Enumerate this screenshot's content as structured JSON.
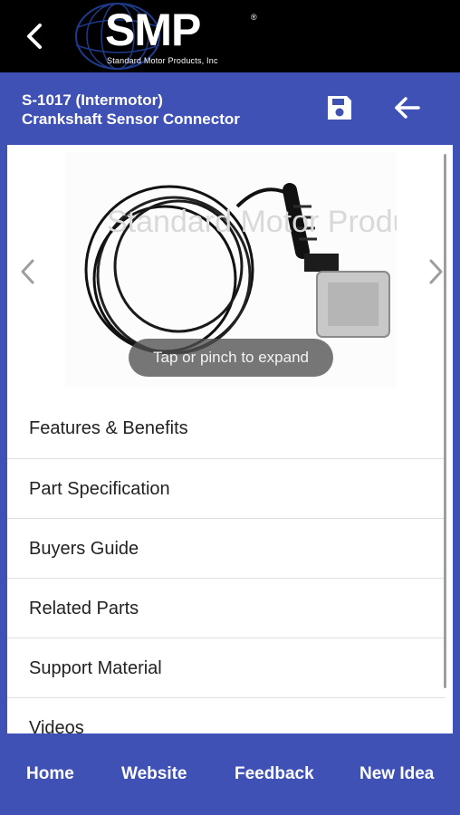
{
  "logo": {
    "brand": "SMP",
    "registered": "®",
    "tagline": "Standard Motor Products, Inc"
  },
  "header": {
    "line1": "S-1017 (Intermotor)",
    "line2": "Crankshaft Sensor Connector"
  },
  "icons": {
    "back": "chevron-left-icon",
    "save": "save-icon",
    "return": "arrow-left-icon",
    "prev": "chevron-left-icon",
    "next": "chevron-right-icon"
  },
  "gallery": {
    "watermark": "Standard Motor Products",
    "hint": "Tap or pinch to expand"
  },
  "menu": {
    "items": [
      {
        "label": "Features & Benefits"
      },
      {
        "label": "Part Specification"
      },
      {
        "label": "Buyers Guide"
      },
      {
        "label": "Related Parts"
      },
      {
        "label": "Support Material"
      },
      {
        "label": "Videos"
      }
    ]
  },
  "bottom_nav": {
    "items": [
      {
        "label": "Home"
      },
      {
        "label": "Website"
      },
      {
        "label": "Feedback"
      },
      {
        "label": "New Idea"
      }
    ]
  },
  "colors": {
    "accent": "#3f51b5",
    "topbar": "#000000",
    "text": "#222222",
    "divider": "#e0e0e0"
  }
}
